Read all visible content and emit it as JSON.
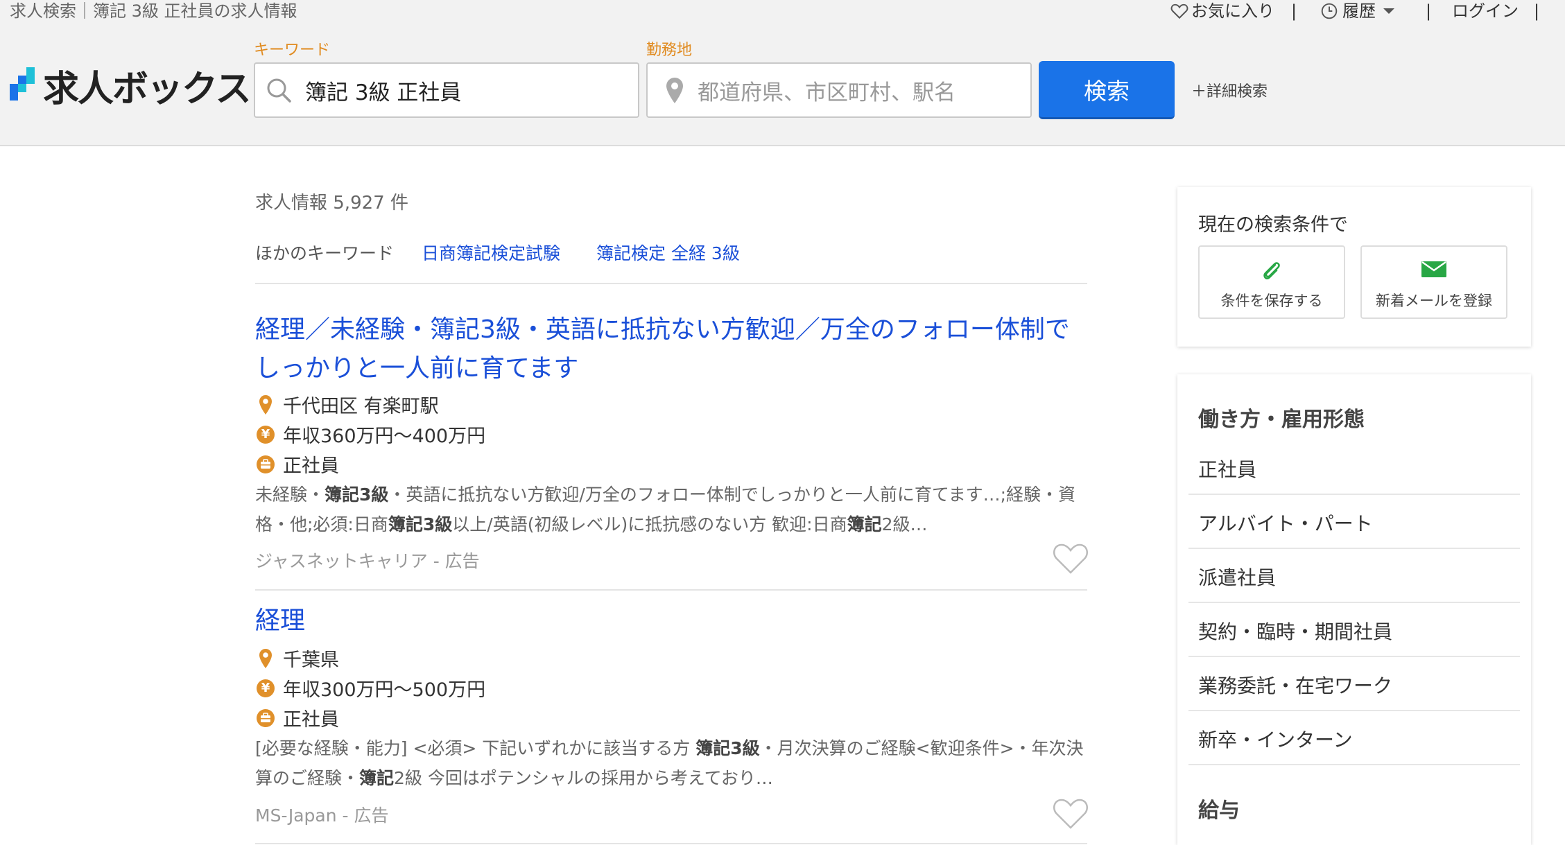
{
  "header": {
    "breadcrumb": "求人検索｜簿記 3級 正社員の求人情報",
    "favorites": "お気に入り",
    "history": "履歴",
    "login": "ログイン",
    "separator": "|",
    "logo_text": "求人ボックス",
    "keyword_label": "キーワード",
    "keyword_value": "簿記 3級 正社員",
    "location_label": "勤務地",
    "location_placeholder": "都道府県、市区町村、駅名",
    "search_button": "検索",
    "advanced_search": "＋詳細検索",
    "accent_color": "#1a73e8",
    "label_color": "#e08a1e"
  },
  "results": {
    "count_text": "求人情報 5,927 件",
    "other_keywords_label": "ほかのキーワード",
    "other_keywords": [
      "日商簿記検定試験",
      "簿記検定 全経 3級"
    ]
  },
  "jobs": [
    {
      "title_line1": "経理／未経験・簿記3級・英語に抵抗ない方歓迎／万全のフォロー体制で",
      "title_line2": "しっかりと一人前に育てます",
      "location": "千代田区 有楽町駅",
      "salary": "年収360万円～400万円",
      "employment": "正社員",
      "desc_parts": [
        {
          "t": "未経験・",
          "b": false
        },
        {
          "t": "簿記3級",
          "b": true
        },
        {
          "t": "・英語に抵抗ない方歓迎/万全のフォロー体制でしっかりと一人前に育てます…;経験・資格・他;必須:日商",
          "b": false
        },
        {
          "t": "簿記3級",
          "b": true
        },
        {
          "t": "以上/英語(初級レベル)に抵抗感のない方 歓迎:日商",
          "b": false
        },
        {
          "t": "簿記",
          "b": true
        },
        {
          "t": "2級…",
          "b": false
        }
      ],
      "source": "ジャスネットキャリア - 広告"
    },
    {
      "title_line1": "経理",
      "title_line2": "",
      "location": "千葉県",
      "salary": "年収300万円～500万円",
      "employment": "正社員",
      "desc_parts": [
        {
          "t": "[必要な経験・能力] <必須> 下記いずれかに該当する方 ",
          "b": false
        },
        {
          "t": "簿記3級",
          "b": true
        },
        {
          "t": "・月次決算のご経験<歓迎条件>・年次決算のご経験・",
          "b": false
        },
        {
          "t": "簿記",
          "b": true
        },
        {
          "t": "2級 今回はポテンシャルの採用から考えており…",
          "b": false
        }
      ],
      "source": "MS-Japan - 広告"
    }
  ],
  "sidebar": {
    "conditions_title": "現在の検索条件で",
    "save_label": "条件を保存する",
    "mail_label": "新着メールを登録",
    "employment_heading": "働き方・雇用形態",
    "employment_items": [
      "正社員",
      "アルバイト・パート",
      "派遣社員",
      "契約・臨時・期間社員",
      "業務委託・在宅ワーク",
      "新卒・インターン"
    ],
    "salary_heading": "給与"
  }
}
